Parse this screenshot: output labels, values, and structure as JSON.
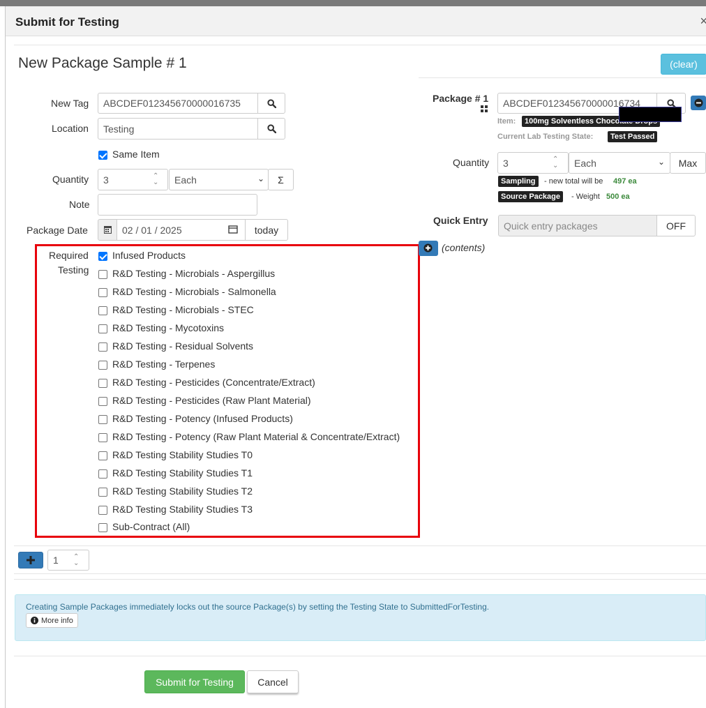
{
  "modal": {
    "title": "Submit for Testing",
    "close": "×"
  },
  "section": {
    "title": "New Package Sample # 1",
    "clear_label": "(clear)"
  },
  "left": {
    "new_tag_label": "New Tag",
    "new_tag_value": "ABCDEF012345670000016735",
    "location_label": "Location",
    "location_value": "Testing",
    "same_item_label": "Same Item",
    "quantity_label": "Quantity",
    "quantity_value": "3",
    "unit_value": "Each",
    "sigma": "Σ",
    "note_label": "Note",
    "note_value": "",
    "package_date_label": "Package Date",
    "package_date_value": "02 / 01 / 2025",
    "today_label": "today",
    "required_label_1": "Required",
    "required_label_2": "Testing"
  },
  "testing_items": [
    {
      "label": "Infused Products",
      "checked": true
    },
    {
      "label": "R&D Testing - Microbials - Aspergillus",
      "checked": false
    },
    {
      "label": "R&D Testing - Microbials - Salmonella",
      "checked": false
    },
    {
      "label": "R&D Testing - Microbials - STEC",
      "checked": false
    },
    {
      "label": "R&D Testing - Mycotoxins",
      "checked": false
    },
    {
      "label": "R&D Testing - Residual Solvents",
      "checked": false
    },
    {
      "label": "R&D Testing - Terpenes",
      "checked": false
    },
    {
      "label": "R&D Testing - Pesticides (Concentrate/Extract)",
      "checked": false
    },
    {
      "label": "R&D Testing - Pesticides (Raw Plant Material)",
      "checked": false
    },
    {
      "label": "R&D Testing - Potency (Infused Products)",
      "checked": false
    },
    {
      "label": "R&D Testing - Potency (Raw Plant Material & Concentrate/Extract)",
      "checked": false
    },
    {
      "label": "R&D Testing Stability Studies T0",
      "checked": false
    },
    {
      "label": "R&D Testing Stability Studies T1",
      "checked": false
    },
    {
      "label": "R&D Testing Stability Studies T2",
      "checked": false
    },
    {
      "label": "R&D Testing Stability Studies T3",
      "checked": false
    },
    {
      "label": "Sub-Contract (All)",
      "checked": false
    }
  ],
  "right": {
    "package_label": "Package # 1",
    "package_value": "ABCDEF012345670000016734",
    "item_label": "Item:",
    "item_value": "100mg Solventless Chocolate Drops",
    "lab_state_label": "Current Lab Testing State:",
    "lab_state_value": "Test Passed",
    "quantity_label": "Quantity",
    "quantity_value": "3",
    "unit_value": "Each",
    "max_label": "Max",
    "sampling_badge": "Sampling",
    "sampling_text": "- new total will be",
    "sampling_total": "497 ea",
    "source_badge": "Source Package",
    "source_text": "- Weight",
    "source_weight": "500 ea",
    "quick_entry_label": "Quick Entry",
    "quick_entry_placeholder": "Quick entry packages",
    "quick_entry_toggle": "OFF",
    "contents_label": "(contents)"
  },
  "add_row": {
    "count_value": "1"
  },
  "alert": {
    "text": "Creating Sample Packages immediately locks out the source Package(s) by setting the Testing State to SubmittedForTesting.",
    "more_info": "More info"
  },
  "footer": {
    "submit_label": "Submit for Testing",
    "cancel_label": "Cancel"
  },
  "colors": {
    "accent": "#5bc0de",
    "primary": "#337ab7",
    "success": "#5cb85c",
    "highlight": "#e8000b"
  }
}
